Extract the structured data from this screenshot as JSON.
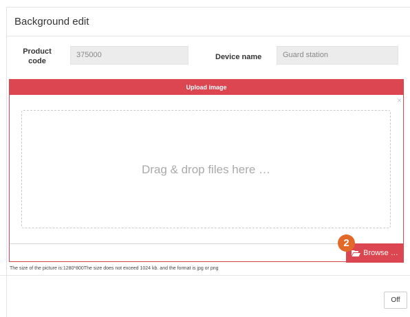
{
  "dialog": {
    "title": "Background edit"
  },
  "form": {
    "product_code_label_line1": "Product",
    "product_code_label_line2": "code",
    "product_code_value": "375000",
    "device_name_label": "Device name",
    "device_name_value": "Guard station"
  },
  "upload": {
    "header": "Upload image",
    "close_glyph": "×",
    "drop_text": "Drag & drop files here …",
    "browse_label": "Browse …",
    "folder_icon": "folder-open-icon",
    "step_badge": "2",
    "hint": "The size of the picture is:1280*800The size does not exceed 1024 kb. and the format is jpg or png"
  },
  "footer": {
    "off_label": "Off"
  },
  "colors": {
    "accent_red": "#dc4650",
    "badge_orange": "#e2692a",
    "field_bg": "#ececec"
  }
}
